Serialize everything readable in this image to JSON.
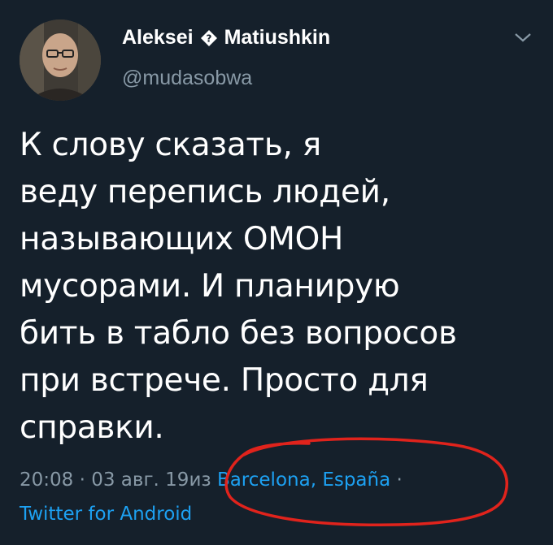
{
  "user": {
    "first_name": "Aleksei",
    "last_name": "Matiushkin",
    "handle": "@mudasobwa",
    "avatar_icon": "avatar-photo"
  },
  "tweet": {
    "text": "К слову сказать, я\nведу перепись людей,\nназывающих ОМОН\nмусорами. И планирую\nбить в табло без вопросов\nпри встрече. Просто для\nсправки."
  },
  "meta": {
    "time": "20:08",
    "separator": " · ",
    "date": "03 авг. 19",
    "from_label": "из ",
    "location": "Barcelona, España",
    "source": "Twitter for Android"
  },
  "colors": {
    "background": "#15202b",
    "text": "#ffffff",
    "secondary": "#8899a6",
    "link": "#1da1f2",
    "annotation": "#e0231c"
  },
  "icons": {
    "separator": "diamond-question-icon",
    "menu": "chevron-down-icon"
  }
}
